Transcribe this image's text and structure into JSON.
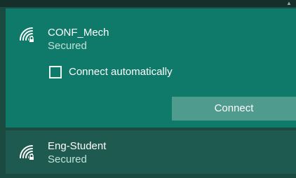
{
  "networks": [
    {
      "ssid": "CONF_Mech",
      "status": "Secured",
      "icon": "wifi-secured-icon",
      "expanded": true,
      "connect_automatically": {
        "label": "Connect automatically",
        "checked": false
      },
      "connect_button_label": "Connect"
    },
    {
      "ssid": "Eng-Student",
      "status": "Secured",
      "icon": "wifi-secured-icon",
      "expanded": false
    }
  ],
  "colors": {
    "selected_bg": "#0f7a6a",
    "other_bg": "#1e5a4f",
    "button_bg": "#4f9b8d"
  }
}
